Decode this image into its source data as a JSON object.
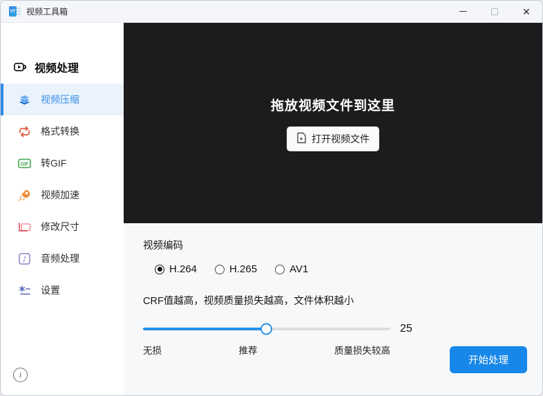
{
  "window": {
    "title": "视频工具箱",
    "app_monogram": "VT"
  },
  "sidebar": {
    "header": "视频处理",
    "items": [
      {
        "label": "视频压缩",
        "active": true
      },
      {
        "label": "格式转换",
        "active": false
      },
      {
        "label": "转GIF",
        "active": false
      },
      {
        "label": "视频加速",
        "active": false
      },
      {
        "label": "修改尺寸",
        "active": false
      },
      {
        "label": "音频处理",
        "active": false
      },
      {
        "label": "设置",
        "active": false
      }
    ],
    "info_glyph": "i"
  },
  "dropzone": {
    "title": "拖放视频文件到这里",
    "open_button": "打开视频文件"
  },
  "encoding": {
    "label": "视频编码",
    "options": [
      {
        "label": "H.264",
        "selected": true
      },
      {
        "label": "H.265",
        "selected": false
      },
      {
        "label": "AV1",
        "selected": false
      }
    ]
  },
  "crf": {
    "description": "CRF值越高，视频质量损失越高，文件体积越小",
    "value": "25",
    "slider_percent": 50,
    "labels": {
      "left": "无损",
      "center": "推荐",
      "right": "质量损失较高"
    }
  },
  "actions": {
    "start": "开始处理"
  },
  "icons": {
    "gif_badge_text": "GIF",
    "audio_note": "♪"
  },
  "colors": {
    "accent": "#2492eb",
    "dropzone_bg": "#1c1c1e",
    "sidebar_active_bg": "#eaf3fc",
    "sidebar_active_text": "#3a8ee6",
    "start_button_bg": "#1787e9"
  }
}
